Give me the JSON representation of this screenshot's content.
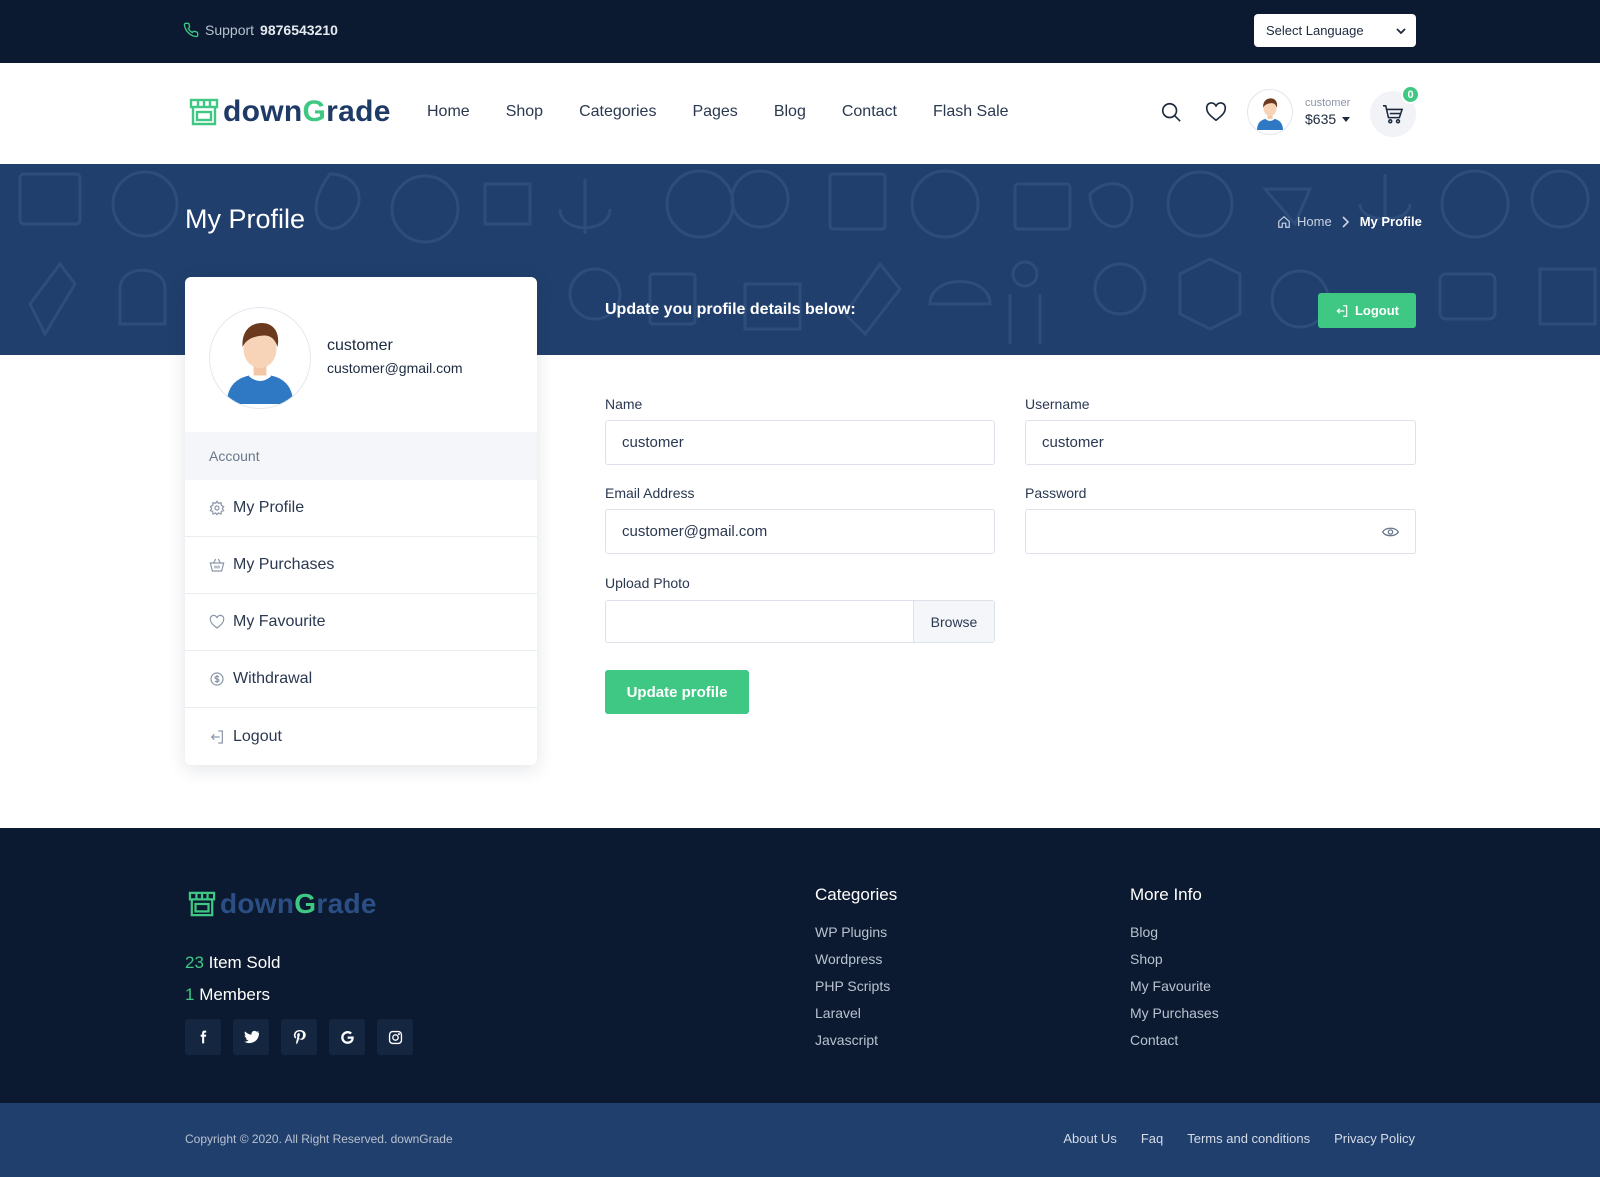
{
  "topbar": {
    "support_label": "Support",
    "support_phone": "9876543210",
    "language_select": "Select Language"
  },
  "header": {
    "logo_part1": "down",
    "logo_part2": "G",
    "logo_part3": "rade",
    "nav": [
      "Home",
      "Shop",
      "Categories",
      "Pages",
      "Blog",
      "Contact",
      "Flash Sale"
    ],
    "account_name": "customer",
    "account_balance": "$635",
    "cart_count": "0"
  },
  "banner": {
    "title": "My Profile",
    "breadcrumb": [
      "Home",
      "My Profile"
    ],
    "update_heading": "Update you profile details below:",
    "logout_label": "Logout"
  },
  "sidebar": {
    "name": "customer",
    "email": "customer@gmail.com",
    "section_label": "Account",
    "items": [
      {
        "label": "My Profile",
        "icon": "gear-icon"
      },
      {
        "label": "My Purchases",
        "icon": "basket-icon"
      },
      {
        "label": "My Favourite",
        "icon": "heart-icon"
      },
      {
        "label": "Withdrawal",
        "icon": "money-icon"
      },
      {
        "label": "Logout",
        "icon": "logout-icon"
      }
    ]
  },
  "form": {
    "name_label": "Name",
    "name_value": "customer",
    "username_label": "Username",
    "username_value": "customer",
    "email_label": "Email Address",
    "email_value": "customer@gmail.com",
    "password_label": "Password",
    "password_value": "",
    "photo_label": "Upload Photo",
    "browse_label": "Browse",
    "submit_label": "Update profile"
  },
  "footer": {
    "items_sold_num": "23",
    "items_sold_label": " Item Sold",
    "members_num": "1",
    "members_label": " Members",
    "socials": [
      "facebook-icon",
      "twitter-icon",
      "pinterest-icon",
      "google-icon",
      "instagram-icon"
    ],
    "categories_title": "Categories",
    "categories": [
      "WP Plugins",
      "Wordpress",
      "PHP Scripts",
      "Laravel",
      "Javascript"
    ],
    "moreinfo_title": "More Info",
    "moreinfo": [
      "Blog",
      "Shop",
      "My Favourite",
      "My Purchases",
      "Contact"
    ],
    "copyright": "Copyright © 2020. All Right Reserved. downGrade",
    "bottom_links": [
      "About Us",
      "Faq",
      "Terms and conditions",
      "Privacy Policy"
    ]
  },
  "colors": {
    "dark_navy": "#0b1a30",
    "banner_blue": "#213f6c",
    "accent_green": "#3fc884"
  }
}
